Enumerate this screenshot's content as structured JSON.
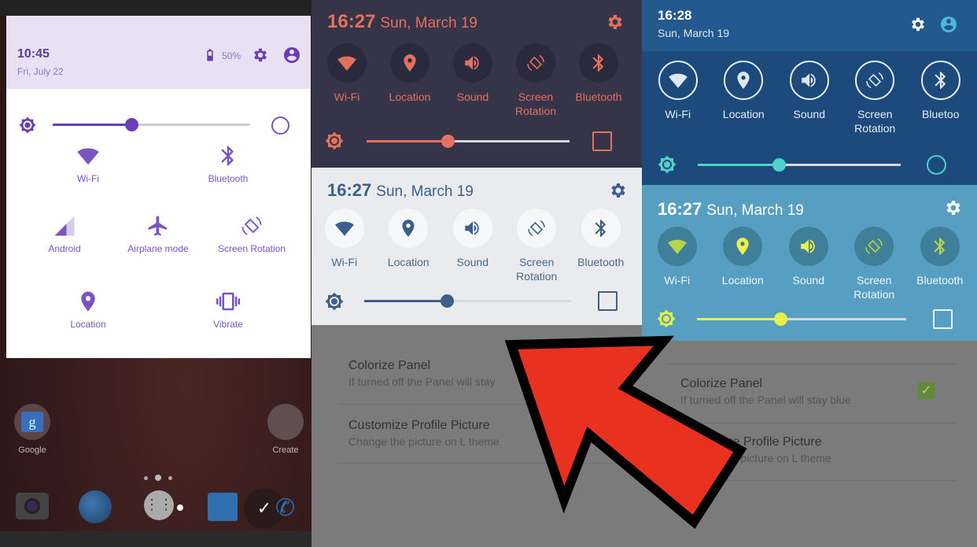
{
  "left_panel": {
    "time": "10:45",
    "date": "Fri, July 22",
    "battery": "50%",
    "brightness_level": 0.4,
    "accent": "#6a3fb5",
    "tiles": [
      {
        "label": "Wi-Fi",
        "icon": "wifi-icon"
      },
      {
        "label": "Bluetooth",
        "icon": "bluetooth-icon"
      },
      {
        "label": "Android",
        "icon": "signal-icon"
      },
      {
        "label": "Airplane mode",
        "icon": "airplane-icon"
      },
      {
        "label": "Screen Rotation",
        "icon": "rotation-icon"
      },
      {
        "label": "Location",
        "icon": "location-icon"
      },
      {
        "label": "Vibrate",
        "icon": "vibrate-icon"
      }
    ]
  },
  "home": {
    "apps": [
      {
        "label": "Google"
      },
      {
        "label": "Create"
      }
    ]
  },
  "panels": [
    {
      "id": "dark-coral",
      "time": "16:27",
      "date": "Sun, March 19",
      "brightness_level": 0.4,
      "accent": "#e4705f",
      "bg": "#353448",
      "tiles": [
        {
          "label": "Wi-Fi",
          "icon": "wifi-icon"
        },
        {
          "label": "Location",
          "icon": "location-icon"
        },
        {
          "label": "Sound",
          "icon": "sound-icon"
        },
        {
          "label": "Screen Rotation",
          "icon": "rotation-icon"
        },
        {
          "label": "Bluetooth",
          "icon": "bluetooth-icon"
        }
      ]
    },
    {
      "id": "light",
      "time": "16:27",
      "date": "Sun, March 19",
      "brightness_level": 0.4,
      "accent": "#3d5f8c",
      "bg": "#e9ebee",
      "tiles": [
        {
          "label": "Wi-Fi",
          "icon": "wifi-icon"
        },
        {
          "label": "Location",
          "icon": "location-icon"
        },
        {
          "label": "Sound",
          "icon": "sound-icon"
        },
        {
          "label": "Screen Rotation",
          "icon": "rotation-icon"
        },
        {
          "label": "Bluetooth",
          "icon": "bluetooth-icon"
        }
      ]
    },
    {
      "id": "blue-dark",
      "time": "16:28",
      "date": "Sun, March 19",
      "brightness_level": 0.4,
      "accent": "#4fd0c8",
      "bg": "#1d4a7d",
      "tiles": [
        {
          "label": "Wi-Fi",
          "icon": "wifi-icon"
        },
        {
          "label": "Location",
          "icon": "location-icon"
        },
        {
          "label": "Sound",
          "icon": "sound-icon"
        },
        {
          "label": "Screen Rotation",
          "icon": "rotation-icon"
        },
        {
          "label": "Bluetoo",
          "icon": "bluetooth-icon"
        }
      ]
    },
    {
      "id": "blue-light",
      "time": "16:27",
      "date": "Sun, March 19",
      "brightness_level": 0.4,
      "accent": "#e6f04a",
      "bg": "#569fc2",
      "tiles": [
        {
          "label": "Wi-Fi",
          "icon": "wifi-icon"
        },
        {
          "label": "Location",
          "icon": "location-icon"
        },
        {
          "label": "Sound",
          "icon": "sound-icon"
        },
        {
          "label": "Screen Rotation",
          "icon": "rotation-icon"
        },
        {
          "label": "Bluetooth",
          "icon": "bluetooth-icon"
        }
      ]
    }
  ],
  "settings": {
    "colorize_title": "Colorize Panel",
    "colorize_sub_left": "If turned off the Panel will stay",
    "colorize_sub": "If turned off the Panel will stay blue",
    "colorize_checked": true,
    "profile_title": "Customize Profile Picture",
    "profile_sub": "Change the picture on L theme"
  },
  "arrow_color": "#e8321f"
}
